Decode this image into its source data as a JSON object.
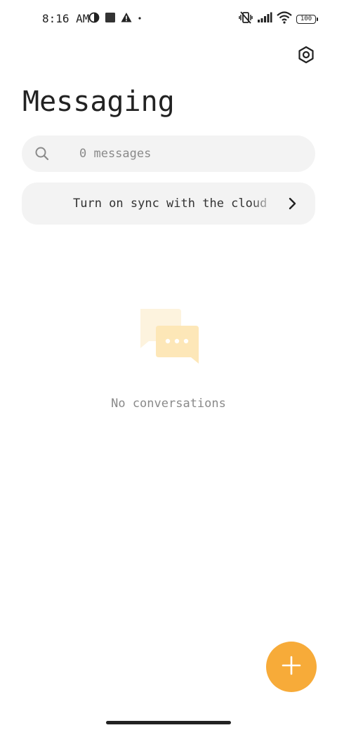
{
  "status_bar": {
    "time": "8:16 AM",
    "battery": "100",
    "icons_left": [
      "data-saver-icon",
      "square-notification-icon",
      "warning-icon",
      "dot-icon"
    ],
    "icons_right": [
      "vibrate-off-icon",
      "signal-icon",
      "wifi-icon",
      "battery-icon"
    ]
  },
  "header": {
    "title": "Messaging",
    "settings_icon": "settings-hexagon-icon"
  },
  "search": {
    "placeholder": "0 messages",
    "icon": "search-icon"
  },
  "sync_banner": {
    "label": "Turn on sync with the cloud",
    "icon": "chevron-right-icon"
  },
  "empty_state": {
    "icon": "chat-bubbles-icon",
    "text": "No conversations"
  },
  "fab": {
    "icon": "plus-icon",
    "color": "#f7ab39"
  },
  "colors": {
    "accent": "#f7ab39",
    "surface": "#f3f3f3",
    "text_primary": "#222222",
    "text_secondary": "#8a8a8a"
  }
}
